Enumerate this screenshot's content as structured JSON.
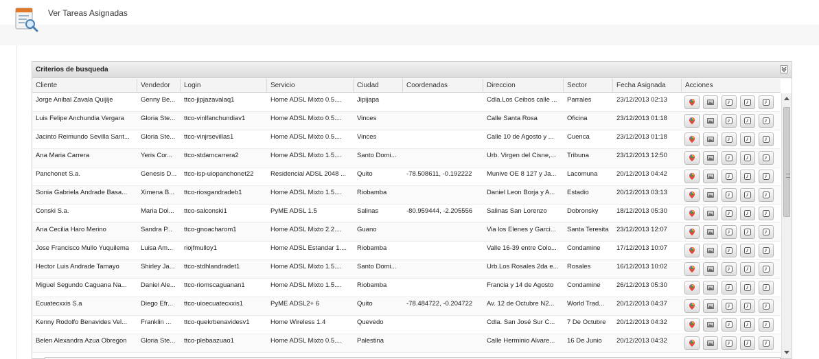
{
  "page": {
    "title": "Ver Tareas Asignadas"
  },
  "panel": {
    "title": "Criterios de busqueda"
  },
  "columns": [
    "Cliente",
    "Vendedor",
    "Login",
    "Servicio",
    "Ciudad",
    "Coordenadas",
    "Direccion",
    "Sector",
    "Fecha Asignada",
    "Acciones"
  ],
  "rows": [
    [
      "Jorge Anibal Zavala Quijije",
      "Genny Be...",
      "ttco-jipjazavalaq1",
      "Home ADSL Mixto 0.5....",
      "Jipijapa",
      "",
      "Cdla.Los Ceibos calle ...",
      "Parrales",
      "23/12/2013 02:13"
    ],
    [
      "Luis Felipe Anchundia Vergara",
      "Gloria Ste...",
      "ttco-vinlfanchundiav1",
      "Home ADSL Mixto 0.5....",
      "Vinces",
      "",
      "Calle Santa Rosa",
      "Oficina",
      "23/12/2013 01:18"
    ],
    [
      "Jacinto Reimundo Sevilla Sant...",
      "Gloria Ste...",
      "ttco-vinjrsevillas1",
      "Home ADSL Mixto 0.5....",
      "Vinces",
      "",
      "Calle 10 de Agosto y ...",
      "Cuenca",
      "23/12/2013 01:18"
    ],
    [
      "Ana Maria Carrera",
      "Yeris Cor...",
      "ttco-stdamcarrera2",
      "Home ADSL Mixto 1.5....",
      "Santo Domi...",
      "",
      "Urb. Virgen del Cisne,...",
      "Tribuna",
      "23/12/2013 12:50"
    ],
    [
      "Panchonet S.a.",
      "Genesis D...",
      "ttco-isp-uiopanchonet22",
      "Residencial ADSL 2048 ...",
      "Quito",
      "-78.508611, -0.192222",
      "Munive OE 8 127 y Ja...",
      "Lacomuna",
      "20/12/2013 04:42"
    ],
    [
      "Sonia Gabriela Andrade Basa...",
      "Ximena B...",
      "ttco-riosgandradeb1",
      "Home ADSL Mixto 1.5....",
      "Riobamba",
      "",
      "Daniel Leon Borja y A...",
      "Estadio",
      "20/12/2013 03:13"
    ],
    [
      "Conski S.a.",
      "Maria Dol...",
      "ttco-salconski1",
      "PyME ADSL 1.5",
      "Salinas",
      "-80.959444, -2.205556",
      "Salinas San Lorenzo",
      "Dobronsky",
      "18/12/2013 05:30"
    ],
    [
      "Ana Cecilia Haro Merino",
      "Sandra P...",
      "ttco-gnoacharom1",
      "Home ADSL Mixto 2.2....",
      "Guano",
      "",
      "Via los Elenes y Garci...",
      "Santa Teresita",
      "23/12/2013 12:07"
    ],
    [
      "Jose Francisco Mullo Yuquilema",
      "Luisa Am...",
      "riojfmulloy1",
      "Home ADSL Estandar 1....",
      "Riobamba",
      "",
      "Valle 16-39 entre Colo...",
      "Condamine",
      "17/12/2013 10:07"
    ],
    [
      "Hector Luis Andrade Tamayo",
      "Shirley Ja...",
      "ttco-stdhlandradet1",
      "Home ADSL Mixto 1.5....",
      "Santo Domi...",
      "",
      "Urb.Los Rosales 2da e...",
      "Rosales",
      "16/12/2013 10:02"
    ],
    [
      "Miguel Segundo Caguana Na...",
      "Daniel Ale...",
      "ttco-riomscaguanan1",
      "Home ADSL Mixto 1.5....",
      "Riobamba",
      "",
      "Francia y 14 de Agosto",
      "Condamine",
      "26/12/2013 05:30"
    ],
    [
      "Ecuatecxxis S.a",
      "Diego Efr...",
      "ttco-uioecuatecxxis1",
      "PyME ADSL2+ 6",
      "Quito",
      "-78.484722, -0.204722",
      "Av. 12 de Octubre N2...",
      "World Trad...",
      "20/12/2013 04:37"
    ],
    [
      "Kenny Rodolfo Benavides Vel...",
      "Franklin ...",
      "ttco-quekrbenavidesv1",
      "Home Wireless 1.4",
      "Quevedo",
      "",
      "Cdla. San José Sur C...",
      "7 De Octubre",
      "20/12/2013 04:32"
    ],
    [
      "Belen Alexandra Azua Obregon",
      "Gloria Ste...",
      "ttco-plebaazuao1",
      "Home ADSL Mixto 0.5....",
      "Palestina",
      "",
      "Calle Herminio Alvare...",
      "16 De Junio",
      "20/12/2013 04:32"
    ]
  ],
  "action_icons": [
    "map-pin-icon",
    "image-icon",
    "clock-icon",
    "clock-icon",
    "clock-icon"
  ]
}
